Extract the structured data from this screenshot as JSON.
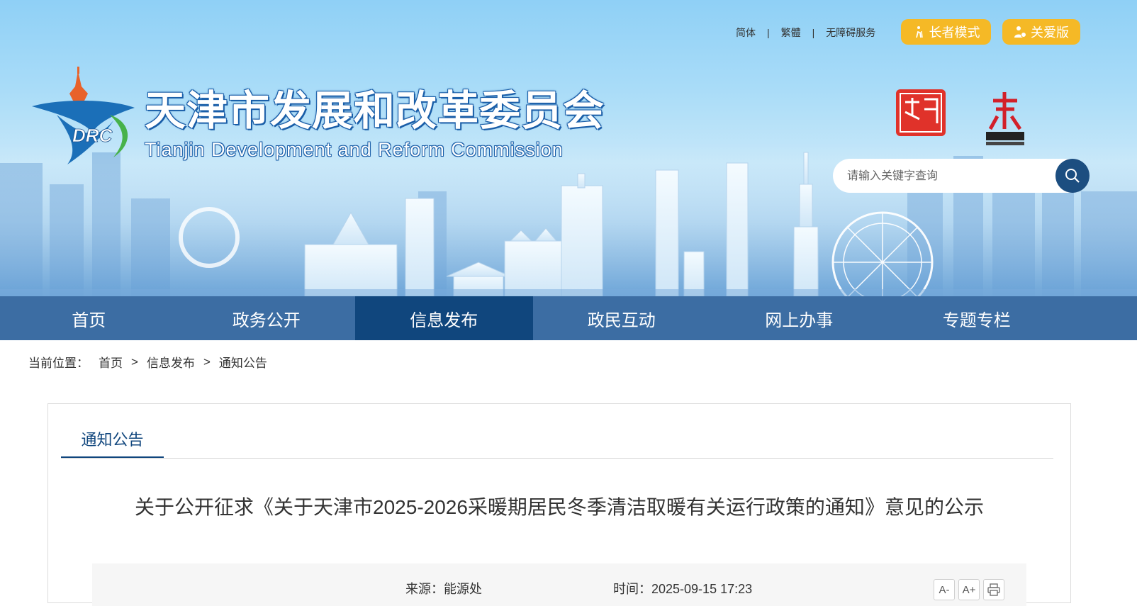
{
  "header": {
    "links": [
      "简体",
      "繁體",
      "无障碍服务"
    ],
    "separator": "|",
    "elder_mode_label": "长者模式",
    "care_mode_label": "关爱版",
    "logo_text": "DRC",
    "title_cn": "天津市发展和改革委员会",
    "title_en": "Tianjin Development and Reform Commission",
    "search_placeholder": "请输入关键字查询",
    "accent_color": "#f5b926",
    "search_icon": "search-icon"
  },
  "nav": {
    "items": [
      "首页",
      "政务公开",
      "信息发布",
      "政民互动",
      "网上办事",
      "专题专栏"
    ],
    "active_index": 2,
    "color": "#3c6da3",
    "active_color": "#10467d"
  },
  "breadcrumb": {
    "label": "当前位置：",
    "items": [
      "首页",
      "信息发布",
      "通知公告"
    ],
    "separator": ">"
  },
  "content": {
    "tab_label": "通知公告",
    "title": "关于公开征求《关于天津市2025-2026采暖期居民冬季清洁取暖有关运行政策的通知》意见的公示",
    "source_label": "来源：",
    "source": "能源处",
    "time_label": "时间：",
    "time": "2025-09-15 17:23",
    "tools": {
      "font_decrease": "A-",
      "font_increase": "A+",
      "print_icon": "printer-icon"
    }
  }
}
